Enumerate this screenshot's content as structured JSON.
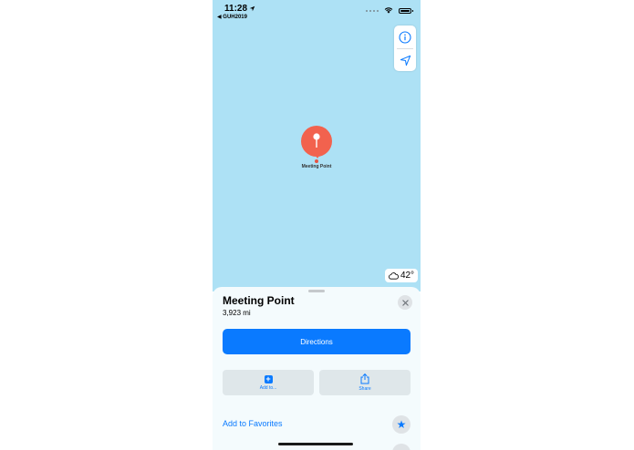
{
  "status_bar": {
    "time": "11:28",
    "back_app": "◀ GUH2019"
  },
  "map": {
    "pin_label": "Meeting Point",
    "weather": {
      "icon": "cloud-icon",
      "temperature": "42°"
    },
    "controls": [
      "info-icon",
      "location-arrow-icon"
    ]
  },
  "sheet": {
    "title": "Meeting Point",
    "distance": "3,923 mi",
    "directions_label": "Directions",
    "actions": [
      {
        "label": "Add to...",
        "icon": "plus-icon"
      },
      {
        "label": "Share",
        "icon": "share-icon"
      }
    ],
    "favorites_label": "Add to Favorites"
  },
  "colors": {
    "accent": "#0a7aff",
    "pin": "#f2624e",
    "map_water": "#ade1f5"
  }
}
